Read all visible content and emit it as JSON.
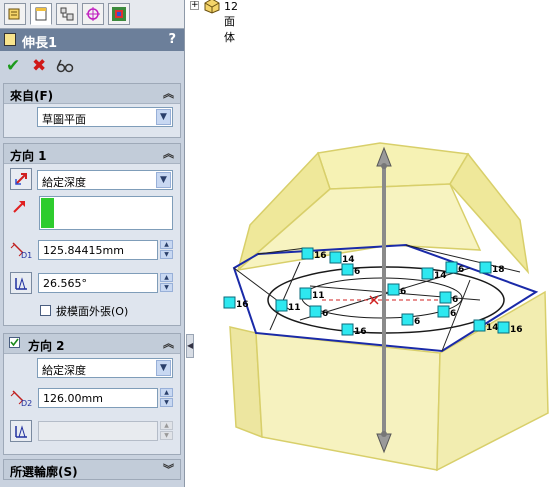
{
  "feature": {
    "title": "伸長1",
    "help": "?",
    "actions": {
      "ok": "✔",
      "cancel": "✖",
      "preview": "6ổ"
    }
  },
  "from": {
    "header": "來自(F)",
    "value": "草圖平面"
  },
  "direction1": {
    "header": "方向 1",
    "end_condition": "給定深度",
    "depth": "125.84415mm",
    "draft_angle": "26.565°",
    "draft_outward": "拔模面外張(O)"
  },
  "direction2": {
    "header": "方向 2",
    "enabled": true,
    "end_condition": "給定深度",
    "depth": "126.00mm",
    "draft_angle": ""
  },
  "selected_contours": {
    "header": "所選輪廓(S)"
  },
  "tree": {
    "item": "12面体"
  },
  "icon_labels": {
    "d1": "D1",
    "d2": "D2"
  },
  "relations": [
    {
      "text": "16"
    },
    {
      "text": "14"
    },
    {
      "text": "6"
    },
    {
      "text": "18"
    },
    {
      "text": "6"
    },
    {
      "text": "14"
    },
    {
      "text": "16"
    },
    {
      "text": "6"
    },
    {
      "text": "11"
    },
    {
      "text": "6"
    },
    {
      "text": "11"
    },
    {
      "text": "16"
    },
    {
      "text": "6"
    },
    {
      "text": "6"
    },
    {
      "text": "14"
    },
    {
      "text": "16"
    },
    {
      "text": "6"
    }
  ],
  "colors": {
    "panel": "#c9d2df",
    "title": "#6c7f9a",
    "preview_fill": "#f4f0a8",
    "preview_edge": "#d8d070",
    "sketch": "#1a2aa8",
    "relation_tag": "#2ee8f0"
  }
}
